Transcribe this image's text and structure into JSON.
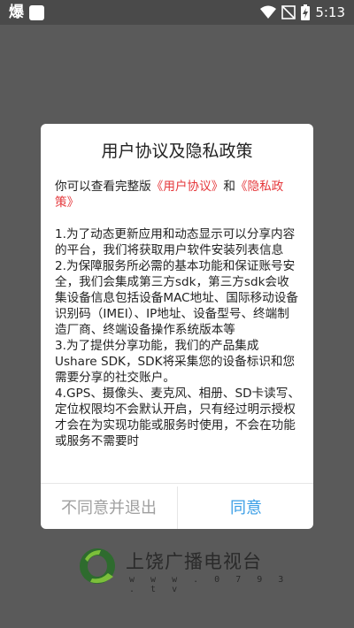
{
  "status_bar": {
    "app_icon_text": "爆",
    "time": "5:13",
    "icons": [
      "wifi-icon",
      "no-signal-icon",
      "battery-charging-icon"
    ]
  },
  "dialog": {
    "title": "用户协议及隐私政策",
    "intro_prefix": "你可以查看完整版",
    "user_agreement_link": "《用户协议》",
    "intro_and": "和",
    "privacy_policy_link": "《隐私政策》",
    "paragraphs": [
      "1.为了动态更新应用和动态显示可以分享内容的平台，我们将获取用户软件安装列表信息",
      "2.为保障服务所必需的基本功能和保证账号安全，我们会集成第三方sdk，第三方sdk会收集设备信息包括设备MAC地址、国际移动设备识别码（IMEI）、IP地址、设备型号、终端制造厂商、终端设备操作系统版本等",
      "3.为了提供分享功能，我们的产品集成Ushare SDK，SDK将采集您的设备标识和您需要分享的社交账户。",
      "4.GPS、摄像头、麦克风、相册、SD卡读写、定位权限均不会默认开启，只有经过明示授权才会在为实现功能或服务时使用，不会在功能或服务不需要时"
    ],
    "decline_label": "不同意并退出",
    "accept_label": "同意"
  },
  "brand": {
    "name": "上饶广播电视台",
    "url": "w w w . 0 7 9 3 . t v"
  },
  "colors": {
    "link": "#e5373b",
    "accept": "#3a9ee6",
    "decline": "#a0a0a0",
    "overlay": "#5a5a5a"
  }
}
